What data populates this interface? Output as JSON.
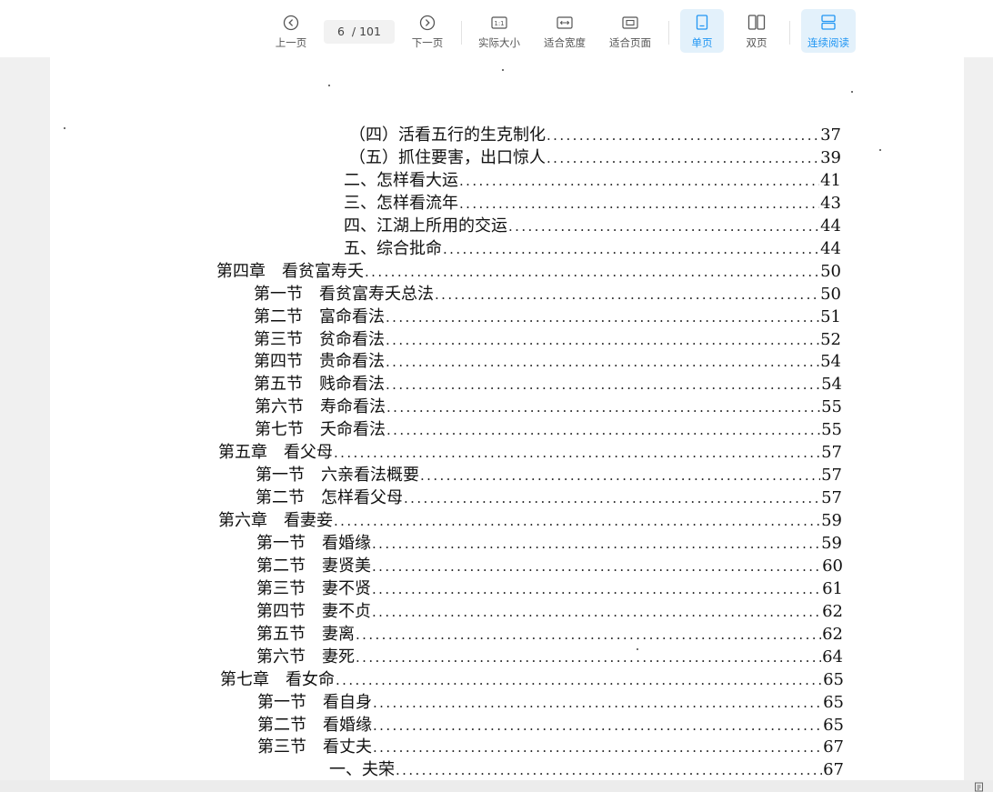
{
  "toolbar": {
    "prev_label": "上一页",
    "next_label": "下一页",
    "page_current": "6",
    "page_total": "/ 101",
    "actual_size_label": "实际大小",
    "fit_width_label": "适合宽度",
    "fit_page_label": "适合页面",
    "single_page_label": "单页",
    "double_page_label": "双页",
    "continuous_label": "连续阅读",
    "active_modes": [
      "单页",
      "连续阅读"
    ],
    "accent_color": "#2196f3"
  },
  "toc": [
    {
      "title": "（四）活看五行的生克制化",
      "page": "37"
    },
    {
      "title": "（五）抓住要害，出口惊人",
      "page": "39"
    },
    {
      "title": "二、怎样看大运",
      "page": "41"
    },
    {
      "title": "三、怎样看流年",
      "page": "43"
    },
    {
      "title": "四、江湖上所用的交运",
      "page": "44"
    },
    {
      "title": "五、综合批命",
      "page": "44"
    },
    {
      "title": "第四章　看贫富寿夭",
      "page": "50"
    },
    {
      "title": "第一节　看贫富寿夭总法",
      "page": "50"
    },
    {
      "title": "第二节　富命看法",
      "page": "51"
    },
    {
      "title": "第三节　贫命看法",
      "page": "52"
    },
    {
      "title": "第四节　贵命看法",
      "page": "54"
    },
    {
      "title": "第五节　贱命看法",
      "page": "54"
    },
    {
      "title": "第六节　寿命看法",
      "page": "55"
    },
    {
      "title": "第七节　夭命看法",
      "page": "55"
    },
    {
      "title": "第五章　看父母",
      "page": "57"
    },
    {
      "title": "第一节　六亲看法概要",
      "page": "57"
    },
    {
      "title": "第二节　怎样看父母",
      "page": "57"
    },
    {
      "title": "第六章　看妻妾",
      "page": "59"
    },
    {
      "title": "第一节　看婚缘",
      "page": "59"
    },
    {
      "title": "第二节　妻贤美",
      "page": "60"
    },
    {
      "title": "第三节　妻不贤",
      "page": "61"
    },
    {
      "title": "第四节　妻不贞",
      "page": "62"
    },
    {
      "title": "第五节　妻离",
      "page": "62"
    },
    {
      "title": "第六节　妻死",
      "page": "64"
    },
    {
      "title": "第七章　看女命",
      "page": "65"
    },
    {
      "title": "第一节　看自身",
      "page": "65"
    },
    {
      "title": "第二节　看婚缘",
      "page": "65"
    },
    {
      "title": "第三节　看丈夫",
      "page": "67"
    },
    {
      "title": "一、夫荣",
      "page": "67"
    }
  ]
}
